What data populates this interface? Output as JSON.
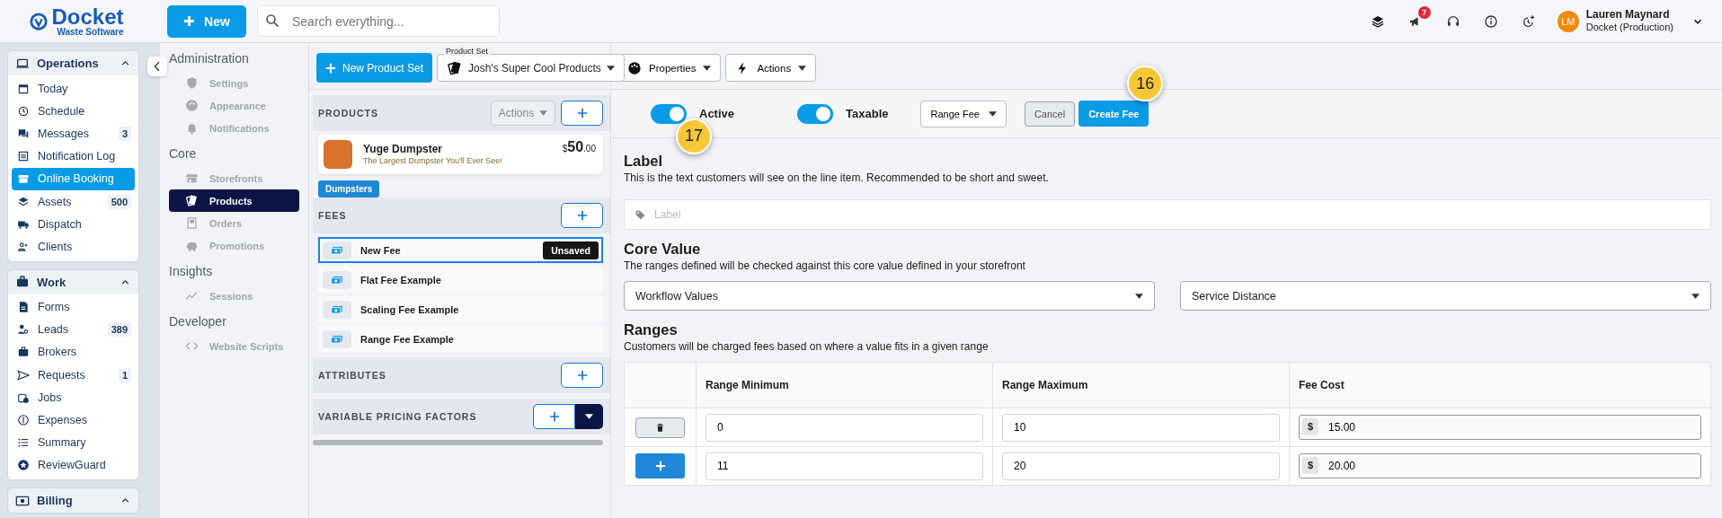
{
  "brand": {
    "name": "Docket",
    "tagline": "Waste Software"
  },
  "new_button": "New",
  "search": {
    "placeholder": "Search everything..."
  },
  "announcements_badge": "7",
  "user": {
    "initials": "LM",
    "name": "Lauren Maynard",
    "org": "Docket (Production)"
  },
  "sidebar": {
    "sections": [
      {
        "title": "Operations",
        "expanded": true,
        "items": [
          {
            "label": "Today",
            "selected": false
          },
          {
            "label": "Schedule",
            "selected": false
          },
          {
            "label": "Messages",
            "selected": false,
            "count": "3"
          },
          {
            "label": "Notification Log",
            "selected": false
          },
          {
            "label": "Online Booking",
            "selected": true
          },
          {
            "label": "Assets",
            "selected": false,
            "count": "500"
          },
          {
            "label": "Dispatch",
            "selected": false
          },
          {
            "label": "Clients",
            "selected": false
          }
        ]
      },
      {
        "title": "Work",
        "expanded": true,
        "items": [
          {
            "label": "Forms",
            "selected": false
          },
          {
            "label": "Leads",
            "selected": false,
            "count": "389"
          },
          {
            "label": "Brokers",
            "selected": false
          },
          {
            "label": "Requests",
            "selected": false,
            "count": "1"
          },
          {
            "label": "Jobs",
            "selected": false
          },
          {
            "label": "Expenses",
            "selected": false
          },
          {
            "label": "Summary",
            "selected": false
          },
          {
            "label": "ReviewGuard",
            "selected": false
          }
        ]
      },
      {
        "title": "Billing",
        "expanded": true
      }
    ]
  },
  "admin_nav": [
    {
      "title": "Administration",
      "items": [
        {
          "label": "Settings",
          "selected": false
        },
        {
          "label": "Appearance",
          "selected": false
        },
        {
          "label": "Notifications",
          "selected": false
        }
      ]
    },
    {
      "title": "Core",
      "items": [
        {
          "label": "Storefronts",
          "selected": false
        },
        {
          "label": "Products",
          "selected": true
        },
        {
          "label": "Orders",
          "selected": false
        },
        {
          "label": "Promotions",
          "selected": false
        }
      ]
    },
    {
      "title": "Insights",
      "items": [
        {
          "label": "Sessions",
          "selected": false
        }
      ]
    },
    {
      "title": "Developer",
      "items": [
        {
          "label": "Website Scripts",
          "selected": false
        }
      ]
    }
  ],
  "toolbar": {
    "new_product_set": "New Product Set",
    "product_set": {
      "label": "Product Set",
      "value": "Josh's Super Cool Products"
    },
    "properties": "Properties",
    "actions": "Actions"
  },
  "products": {
    "title": "PRODUCTS",
    "actions": {
      "label": "Actions",
      "disabled": true
    },
    "product": {
      "name": "Yuge Dumpster",
      "description": "The Largest Dumpster You'll Ever See!",
      "currency": "$",
      "amount": "50",
      "cents": ".00"
    },
    "tag": "Dumpsters"
  },
  "fees": {
    "title": "FEES",
    "items": [
      {
        "name": "New Fee",
        "selected": true,
        "badge": "Unsaved"
      },
      {
        "name": "Flat Fee Example",
        "selected": false
      },
      {
        "name": "Scaling Fee Example",
        "selected": false
      },
      {
        "name": "Range Fee Example",
        "selected": false
      }
    ]
  },
  "attributes": {
    "title": "ATTRIBUTES"
  },
  "variable_pricing": {
    "title": "VARIABLE PRICING FACTORS"
  },
  "fee_form": {
    "toggles": [
      {
        "label": "Active",
        "on": true,
        "callout": "17"
      },
      {
        "label": "Taxable",
        "on": true
      }
    ],
    "fee_type": "Range Fee",
    "cancel": "Cancel",
    "create": {
      "label": "Create Fee",
      "callout": "16"
    },
    "label_section": {
      "heading": "Label",
      "help": "This is the text customers will see on the line item. Recommended to be short and sweet.",
      "placeholder": "Label"
    },
    "core_value": {
      "heading": "Core Value",
      "help": "The ranges defined will be checked against this core value defined in your storefront",
      "selects": [
        "Workflow Values",
        "Service Distance"
      ]
    },
    "ranges": {
      "heading": "Ranges",
      "help": "Customers will be charged fees based on where a value fits in a given range",
      "columns": [
        "Range Minimum",
        "Range Maximum",
        "Fee Cost"
      ],
      "rows": [
        {
          "kind": "delete",
          "min": "0",
          "max": "10",
          "currency": "$",
          "cost": "15.00"
        },
        {
          "kind": "add",
          "min": "11",
          "max": "20",
          "currency": "$",
          "cost": "20.00"
        }
      ]
    }
  }
}
